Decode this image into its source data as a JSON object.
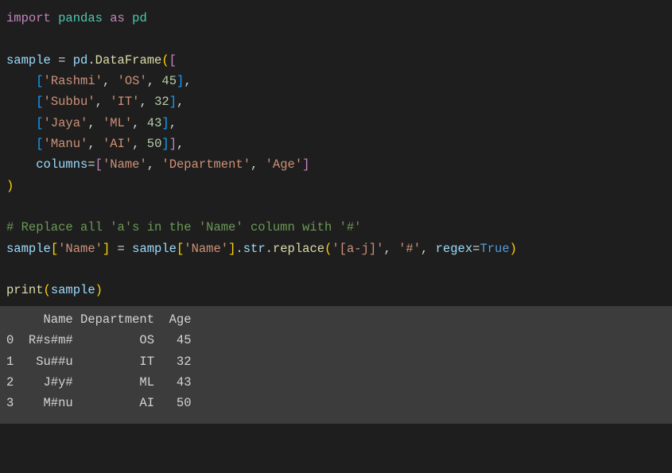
{
  "code": {
    "l1_import": "import",
    "l1_pandas": "pandas",
    "l1_as": "as",
    "l1_pd": "pd",
    "l3_sample": "sample",
    "l3_eq": " = ",
    "l3_pd": "pd",
    "l3_dot": ".",
    "l3_DataFrame": "DataFrame",
    "l3_paren": "(",
    "l3_brkt": "[",
    "row1_open": "[",
    "row1_name": "'Rashmi'",
    "row1_c1": ", ",
    "row1_dept": "'OS'",
    "row1_c2": ", ",
    "row1_age": "45",
    "row1_close": "]",
    "row1_comma": ",",
    "row2_open": "[",
    "row2_name": "'Subbu'",
    "row2_c1": ", ",
    "row2_dept": "'IT'",
    "row2_c2": ", ",
    "row2_age": "32",
    "row2_close": "]",
    "row2_comma": ",",
    "row3_open": "[",
    "row3_name": "'Jaya'",
    "row3_c1": ", ",
    "row3_dept": "'ML'",
    "row3_c2": ", ",
    "row3_age": "43",
    "row3_close": "]",
    "row3_comma": ",",
    "row4_open": "[",
    "row4_name": "'Manu'",
    "row4_c1": ", ",
    "row4_dept": "'AI'",
    "row4_c2": ", ",
    "row4_age": "50",
    "row4_close": "]",
    "row4_closeouter": "]",
    "row4_comma": ",",
    "cols_kw": "columns",
    "cols_eq": "=",
    "cols_open": "[",
    "cols_name": "'Name'",
    "cols_c1": ", ",
    "cols_dept": "'Department'",
    "cols_c2": ", ",
    "cols_age": "'Age'",
    "cols_close": "]",
    "closep": ")",
    "comment": "# Replace all 'a's in the 'Name' column with '#'",
    "assign_sample": "sample",
    "assign_open": "[",
    "assign_name1": "'Name'",
    "assign_close": "]",
    "assign_eq": " = ",
    "assign_sample2": "sample",
    "assign_open2": "[",
    "assign_name2": "'Name'",
    "assign_close2": "]",
    "assign_dot1": ".",
    "assign_str": "str",
    "assign_dot2": ".",
    "assign_replace": "replace",
    "assign_popen": "(",
    "assign_pat": "'[a-j]'",
    "assign_c1": ", ",
    "assign_rep": "'#'",
    "assign_c2": ", ",
    "assign_regex": "regex",
    "assign_req": "=",
    "assign_true": "True",
    "assign_pclose": ")",
    "print_fn": "print",
    "print_open": "(",
    "print_arg": "sample",
    "print_close": ")"
  },
  "output": {
    "header": "     Name Department  Age",
    "r0": "0  R#s#m#         OS   45",
    "r1": "1   Su##u         IT   32",
    "r2": "2    J#y#         ML   43",
    "r3": "3    M#nu         AI   50"
  }
}
